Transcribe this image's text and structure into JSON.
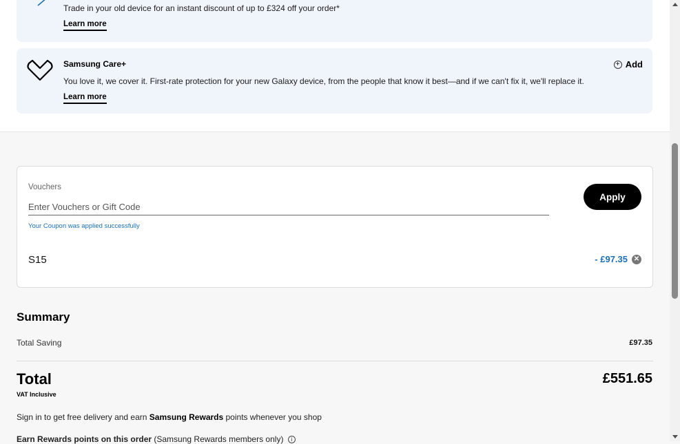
{
  "trade_in": {
    "text": "Trade in your old device for an instant discount of up to £324 off your order*",
    "learn_more": "Learn more"
  },
  "care": {
    "title": "Samsung Care+",
    "text": "You love it, we cover it. First-rate protection for your new Galaxy device, from the people that know it best—and if we can't fix it, we'll replace it.",
    "learn_more": "Learn more",
    "add_label": "Add",
    "icon": "heart-shield-icon"
  },
  "voucher": {
    "label": "Vouchers",
    "placeholder": "Enter Vouchers or Gift Code",
    "apply_label": "Apply",
    "success": "Your Coupon was applied successfully",
    "code": "S15",
    "discount": "- £97.35"
  },
  "summary": {
    "title": "Summary",
    "saving_label": "Total Saving",
    "saving_value": "£97.35",
    "total_label": "Total",
    "vat_label": "VAT Inclusive",
    "total_value": "£551.65",
    "rewards_pre": "Sign in to get free delivery and earn ",
    "rewards_brand": "Samsung Rewards",
    "rewards_post": " points whenever you shop",
    "earn_label": "Earn Rewards points on this order",
    "earn_note": "(Samsung Rewards members only)"
  },
  "colors": {
    "accent_blue": "#1a6fb8",
    "card_bg": "#f0f4fb",
    "button_black": "#000000"
  }
}
